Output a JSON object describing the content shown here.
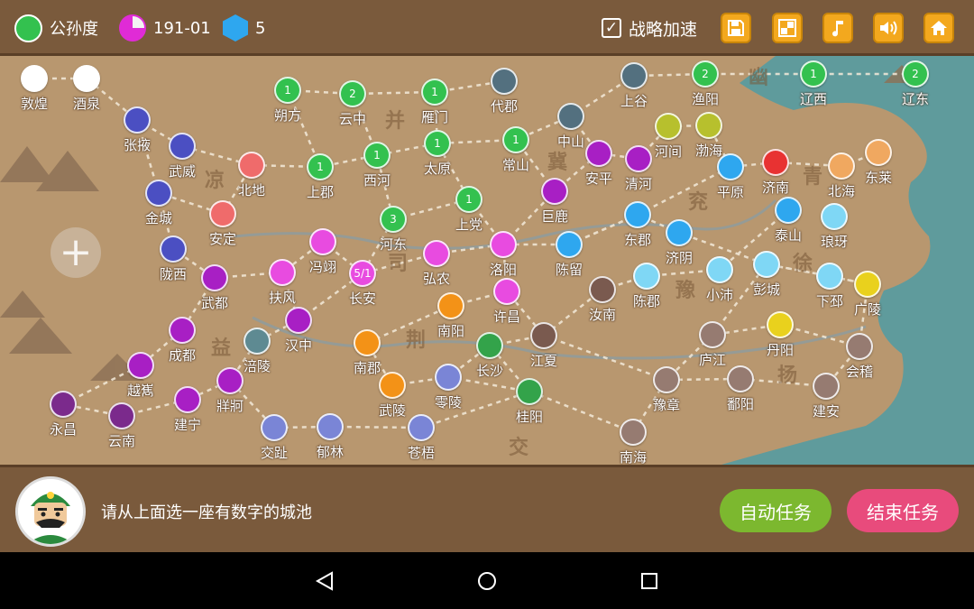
{
  "topbar": {
    "ruler_name": "公孙度",
    "ruler_color": "#33c14f",
    "date": "191-01",
    "city_count": "5",
    "speedup_checked": true,
    "speedup_label": "战略加速",
    "buttons": [
      "save-icon",
      "layout-icon",
      "music-icon",
      "volume-icon",
      "home-icon"
    ]
  },
  "map": {
    "regions": [
      "幽",
      "并",
      "冀",
      "凉",
      "兖",
      "青",
      "司",
      "徐",
      "豫",
      "益",
      "荆",
      "扬",
      "交"
    ],
    "cities": [
      {
        "name": "敦煌",
        "color": "#ffffff",
        "num": ""
      },
      {
        "name": "酒泉",
        "color": "#ffffff",
        "num": ""
      },
      {
        "name": "张掖",
        "color": "#4b4fc2",
        "num": ""
      },
      {
        "name": "武威",
        "color": "#4b4fc2",
        "num": ""
      },
      {
        "name": "金城",
        "color": "#4b4fc2",
        "num": ""
      },
      {
        "name": "陇西",
        "color": "#4b4fc2",
        "num": ""
      },
      {
        "name": "北地",
        "color": "#ef6b6b",
        "num": ""
      },
      {
        "name": "安定",
        "color": "#ef6b6b",
        "num": ""
      },
      {
        "name": "朔方",
        "color": "#33c14f",
        "num": "1"
      },
      {
        "name": "云中",
        "color": "#33c14f",
        "num": "2"
      },
      {
        "name": "雁门",
        "color": "#33c14f",
        "num": "1"
      },
      {
        "name": "代郡",
        "color": "#53707f",
        "num": ""
      },
      {
        "name": "上谷",
        "color": "#53707f",
        "num": ""
      },
      {
        "name": "渔阳",
        "color": "#33c14f",
        "num": "2"
      },
      {
        "name": "辽西",
        "color": "#33c14f",
        "num": "1"
      },
      {
        "name": "辽东",
        "color": "#33c14f",
        "num": "2"
      },
      {
        "name": "上郡",
        "color": "#33c14f",
        "num": "1"
      },
      {
        "name": "西河",
        "color": "#33c14f",
        "num": "1"
      },
      {
        "name": "太原",
        "color": "#33c14f",
        "num": "1"
      },
      {
        "name": "常山",
        "color": "#33c14f",
        "num": "1"
      },
      {
        "name": "中山",
        "color": "#53707f",
        "num": ""
      },
      {
        "name": "河间",
        "color": "#b7c02d",
        "num": ""
      },
      {
        "name": "渤海",
        "color": "#b7c02d",
        "num": ""
      },
      {
        "name": "安平",
        "color": "#a81fc4",
        "num": ""
      },
      {
        "name": "清河",
        "color": "#a81fc4",
        "num": ""
      },
      {
        "name": "上党",
        "color": "#33c14f",
        "num": "1"
      },
      {
        "name": "河东",
        "color": "#33c14f",
        "num": "3"
      },
      {
        "name": "巨鹿",
        "color": "#a81fc4",
        "num": ""
      },
      {
        "name": "平原",
        "color": "#2ea7ef",
        "num": ""
      },
      {
        "name": "济南",
        "color": "#e83232",
        "num": ""
      },
      {
        "name": "北海",
        "color": "#f0a860",
        "num": ""
      },
      {
        "name": "东莱",
        "color": "#f0a860",
        "num": ""
      },
      {
        "name": "东郡",
        "color": "#2ea7ef",
        "num": ""
      },
      {
        "name": "济阴",
        "color": "#2ea7ef",
        "num": ""
      },
      {
        "name": "泰山",
        "color": "#2ea7ef",
        "num": ""
      },
      {
        "name": "琅玡",
        "color": "#7fd7f5",
        "num": ""
      },
      {
        "name": "冯翊",
        "color": "#e84be0",
        "num": ""
      },
      {
        "name": "扶风",
        "color": "#e84be0",
        "num": ""
      },
      {
        "name": "长安",
        "color": "#e84be0",
        "num": "5/1"
      },
      {
        "name": "弘农",
        "color": "#e84be0",
        "num": ""
      },
      {
        "name": "洛阳",
        "color": "#e84be0",
        "num": ""
      },
      {
        "name": "陈留",
        "color": "#2ea7ef",
        "num": ""
      },
      {
        "name": "武都",
        "color": "#a81fc4",
        "num": ""
      },
      {
        "name": "汉中",
        "color": "#a81fc4",
        "num": ""
      },
      {
        "name": "许昌",
        "color": "#e84be0",
        "num": ""
      },
      {
        "name": "汝南",
        "color": "#7a5a4f",
        "num": ""
      },
      {
        "name": "陈郡",
        "color": "#7fd7f5",
        "num": ""
      },
      {
        "name": "小沛",
        "color": "#7fd7f5",
        "num": ""
      },
      {
        "name": "彭城",
        "color": "#7fd7f5",
        "num": ""
      },
      {
        "name": "下邳",
        "color": "#7fd7f5",
        "num": ""
      },
      {
        "name": "广陵",
        "color": "#e9d11d",
        "num": ""
      },
      {
        "name": "成都",
        "color": "#a81fc4",
        "num": ""
      },
      {
        "name": "涪陵",
        "color": "#5e8a92",
        "num": ""
      },
      {
        "name": "南阳",
        "color": "#f39217",
        "num": ""
      },
      {
        "name": "南郡",
        "color": "#f39217",
        "num": ""
      },
      {
        "name": "长沙",
        "color": "#33a34a",
        "num": ""
      },
      {
        "name": "江夏",
        "color": "#7a5a4f",
        "num": ""
      },
      {
        "name": "庐江",
        "color": "#967b71",
        "num": ""
      },
      {
        "name": "丹阳",
        "color": "#e9d11d",
        "num": ""
      },
      {
        "name": "会稽",
        "color": "#967b71",
        "num": ""
      },
      {
        "name": "越嶲",
        "color": "#a81fc4",
        "num": ""
      },
      {
        "name": "牂牁",
        "color": "#a81fc4",
        "num": ""
      },
      {
        "name": "建宁",
        "color": "#a81fc4",
        "num": ""
      },
      {
        "name": "永昌",
        "color": "#7b2a8c",
        "num": ""
      },
      {
        "name": "云南",
        "color": "#7b2a8c",
        "num": ""
      },
      {
        "name": "武陵",
        "color": "#f39217",
        "num": ""
      },
      {
        "name": "零陵",
        "color": "#7a85d6",
        "num": ""
      },
      {
        "name": "桂阳",
        "color": "#33a34a",
        "num": ""
      },
      {
        "name": "豫章",
        "color": "#967b71",
        "num": ""
      },
      {
        "name": "鄱阳",
        "color": "#967b71",
        "num": ""
      },
      {
        "name": "建安",
        "color": "#967b71",
        "num": ""
      },
      {
        "name": "交趾",
        "color": "#7a85d6",
        "num": ""
      },
      {
        "name": "郁林",
        "color": "#7a85d6",
        "num": ""
      },
      {
        "name": "苍梧",
        "color": "#7a85d6",
        "num": ""
      },
      {
        "name": "南海",
        "color": "#967b71",
        "num": ""
      }
    ]
  },
  "bottom": {
    "prompt": "请从上面选一座有数字的城池",
    "auto_button": "自动任务",
    "end_button": "结束任务",
    "auto_color": "#7cb82f",
    "end_color": "#e84b7c"
  }
}
